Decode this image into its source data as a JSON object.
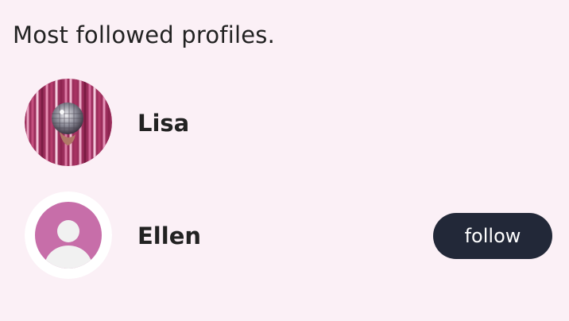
{
  "section": {
    "title": "Most followed profiles."
  },
  "profiles": [
    {
      "name": "Lisa",
      "avatar": "photo-avatar",
      "following": true
    },
    {
      "name": "Ellen",
      "avatar": "default-user-avatar",
      "follow_label": "follow"
    }
  ],
  "colors": {
    "background": "#fbf0f6",
    "button": "#222838",
    "default_avatar": "#c76ea9"
  }
}
